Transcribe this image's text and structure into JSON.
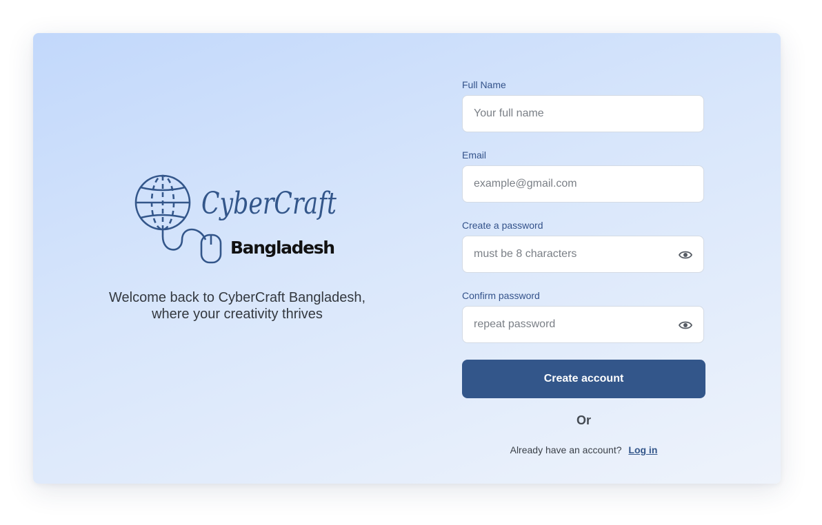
{
  "logo": {
    "brand_script": "CyberCraft",
    "brand_sub": "Bangladesh",
    "icon": "globe-with-mouse-icon"
  },
  "welcome": {
    "line1": "Welcome back to CyberCraft Bangladesh,",
    "line2": "where your creativity thrives"
  },
  "form": {
    "full_name": {
      "label": "Full Name",
      "placeholder": "Your full name",
      "value": ""
    },
    "email": {
      "label": "Email",
      "placeholder": "example@gmail.com",
      "value": ""
    },
    "password": {
      "label": "Create a password",
      "placeholder": "must be 8 characters",
      "value": "",
      "icon": "eye-icon"
    },
    "confirm_password": {
      "label": "Confirm password",
      "placeholder": "repeat password",
      "value": "",
      "icon": "eye-icon"
    },
    "submit_label": "Create account",
    "or_text": "Or",
    "login_prompt": "Already have an account?",
    "login_link": "Log in"
  },
  "colors": {
    "primary": "#33568a",
    "label": "#33528a",
    "logo": "#33568a",
    "background_start": "#c2d8fb",
    "background_end": "#eef3fb"
  }
}
